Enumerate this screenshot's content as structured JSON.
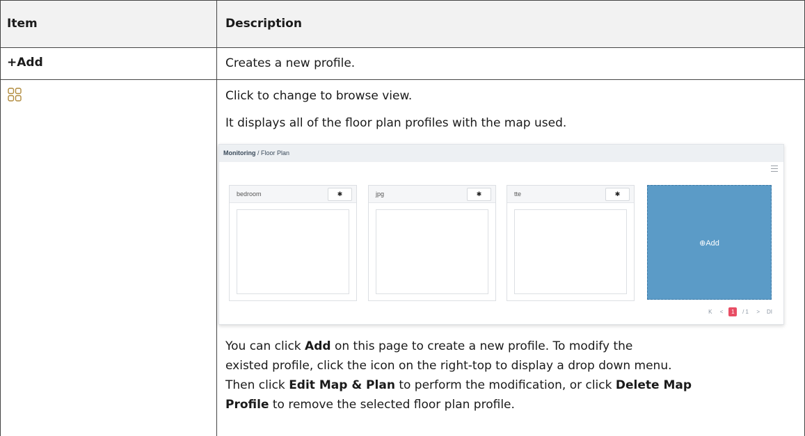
{
  "table": {
    "header": {
      "item": "Item",
      "description": "Description"
    },
    "rows": [
      {
        "item": "+Add",
        "description": "Creates a new profile."
      },
      {
        "item_icon": "grid-view-icon",
        "description_lines": [
          "Click to change to browse view.",
          "It displays all of the floor plan profiles with the map used."
        ]
      }
    ]
  },
  "screenshot": {
    "breadcrumb_parent": "Monitoring",
    "breadcrumb_sep": "/",
    "breadcrumb_current": "Floor Plan",
    "cards": [
      {
        "title": "bedroom"
      },
      {
        "title": "jpg"
      },
      {
        "title": "tte"
      }
    ],
    "add_label": "Add",
    "pager": {
      "first": "K",
      "prev": "<",
      "current": "1",
      "total": "/ 1",
      "next": ">",
      "last": "DI"
    }
  },
  "paragraph": {
    "l1_a": "You can click ",
    "l1_b": "Add",
    "l1_c": " on this page to create a new profile. To modify the",
    "l2": "existed profile, click the icon on the right-top to display a drop down menu.",
    "l3_a": "Then click ",
    "l3_b": "Edit Map & Plan",
    "l3_c": " to perform the modification, or click ",
    "l3_d": "Delete Map",
    "l4_a": "Profile",
    "l4_b": " to remove the selected floor plan profile."
  },
  "colors": {
    "add_tile": "#5b9bc7",
    "pager_active": "#e84d64",
    "grid_icon": "#b08a3c"
  }
}
